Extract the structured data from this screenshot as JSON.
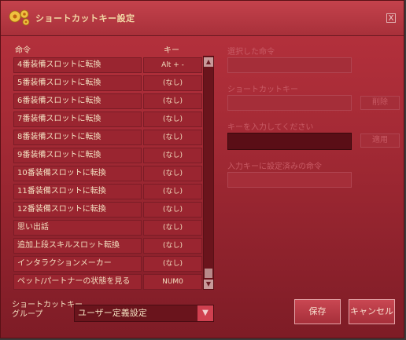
{
  "window": {
    "title": "ショートカットキー設定",
    "close_label": "X"
  },
  "table": {
    "headers": {
      "command": "命令",
      "key": "キー"
    },
    "rows": [
      {
        "command": "4番装備スロットに転換",
        "key": "Alt + -"
      },
      {
        "command": "5番装備スロットに転換",
        "key": "(なし)"
      },
      {
        "command": "6番装備スロットに転換",
        "key": "(なし)"
      },
      {
        "command": "7番装備スロットに転換",
        "key": "(なし)"
      },
      {
        "command": "8番装備スロットに転換",
        "key": "(なし)"
      },
      {
        "command": "9番装備スロットに転換",
        "key": "(なし)"
      },
      {
        "command": "10番装備スロットに転換",
        "key": "(なし)"
      },
      {
        "command": "11番装備スロットに転換",
        "key": "(なし)"
      },
      {
        "command": "12番装備スロットに転換",
        "key": "(なし)"
      },
      {
        "command": "思い出話",
        "key": "(なし)"
      },
      {
        "command": "追加上段スキルスロット転換",
        "key": "(なし)"
      },
      {
        "command": "インタラクションメーカー",
        "key": "(なし)"
      },
      {
        "command": "ペット/パートナーの状態を見る",
        "key": "NUM0"
      }
    ]
  },
  "right_panel": {
    "selected_command_label": "選択した命令",
    "shortcut_key_label": "ショートカットキー",
    "delete_button": "削除",
    "enter_key_label": "キーを入力してください",
    "apply_button": "適用",
    "already_set_label": "入力キーに設定済みの命令"
  },
  "group": {
    "label_line1": "ショートカットキー",
    "label_line2": "グループ",
    "value": "ユーザー定義設定"
  },
  "buttons": {
    "save": "保存",
    "cancel": "キャンセル"
  }
}
